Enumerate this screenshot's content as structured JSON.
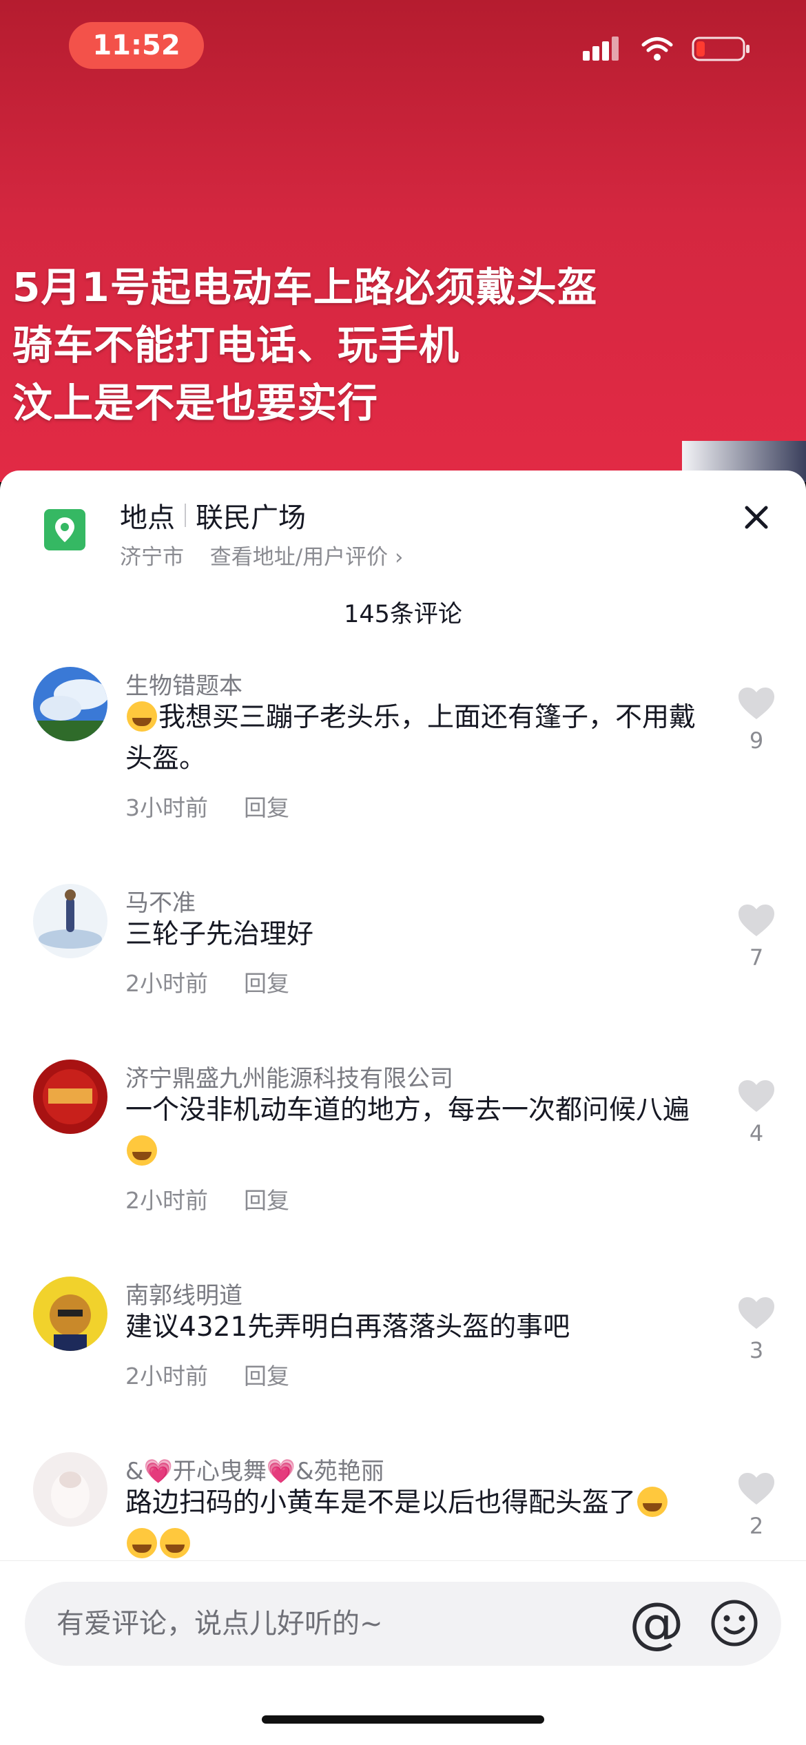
{
  "status": {
    "time": "11:52"
  },
  "video": {
    "headline": "5月1号起电动车上路必须戴头盔\n骑车不能打电话、玩手机\n汶上是不是也要实行"
  },
  "location": {
    "label": "地点",
    "place": "联民广场",
    "city": "济宁市",
    "link": "查看地址/用户评价 ›"
  },
  "comments_count": "145条评论",
  "comments": [
    {
      "name": "生物错题本",
      "text_before": "",
      "text": "我想买三蹦子老头乐，上面还有篷子，不用戴头盔。",
      "time": "3小时前",
      "reply": "回复",
      "likes": "9"
    },
    {
      "name": "马不准",
      "text": "三轮子先治理好",
      "time": "2小时前",
      "reply": "回复",
      "likes": "7"
    },
    {
      "name": "济宁鼎盛九州能源科技有限公司",
      "text": "一个没非机动车道的地方，每去一次都问候八遍",
      "time": "2小时前",
      "reply": "回复",
      "likes": "4"
    },
    {
      "name": "南郭线明道",
      "text": "建议4321先弄明白再落落头盔的事吧",
      "time": "2小时前",
      "reply": "回复",
      "likes": "3"
    },
    {
      "name": "&💗开心曳舞💗&苑艳丽",
      "text": "路边扫码的小黄车是不是以后也得配头盔了",
      "likes": "2"
    }
  ],
  "input": {
    "placeholder": "有爱评论，说点儿好听的~",
    "at": "@"
  },
  "colors": {
    "accent_red": "#e22a45",
    "location_green": "#35b863",
    "text_primary": "#161823",
    "text_secondary": "#8a8b91"
  },
  "icons": [
    "location-pin-icon",
    "close-icon",
    "heart-icon",
    "at-icon",
    "emoji-icon",
    "signal-icon",
    "wifi-icon",
    "battery-icon"
  ]
}
